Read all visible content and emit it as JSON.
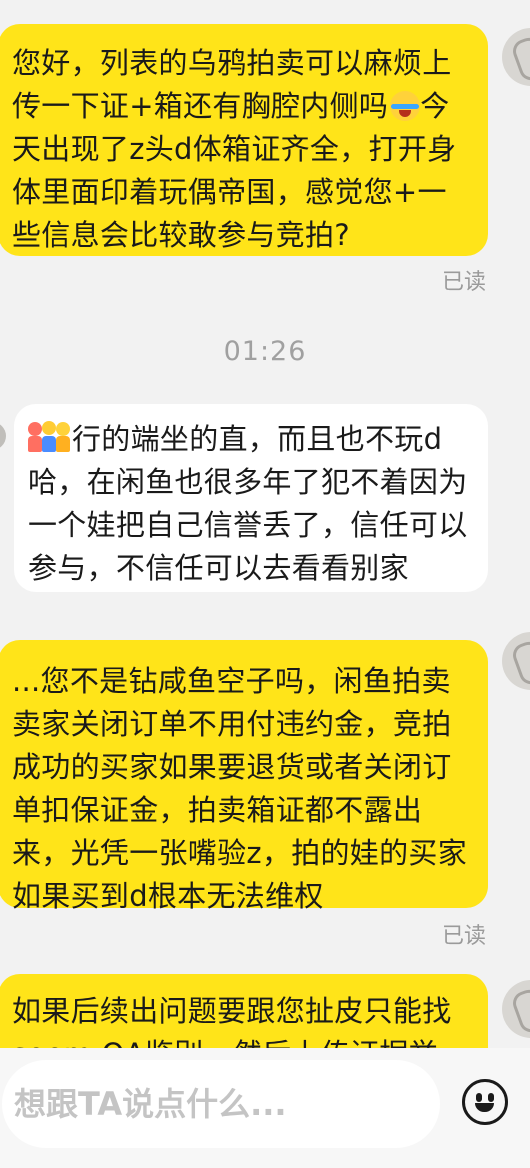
{
  "messages": [
    {
      "side": "me",
      "parts": [
        "您好，列表的乌鸦拍卖可以麻烦上传一下证+箱还有胸腔内侧吗",
        "今天出现了z头d体箱证齐全，打开身体里面印着玩偶帝国，感觉您+一些信息会比较敢参与竞拍?"
      ],
      "emoji": "crying-laughing-emoji",
      "read": "已读"
    },
    {
      "side": "them",
      "emoji": "people-group-emoji",
      "text": "行的端坐的直，而且也不玩d哈，在闲鱼也很多年了犯不着因为一个娃把自己信誉丢了，信任可以参与，不信任可以去看看别家"
    },
    {
      "side": "me",
      "text": "...您不是钻咸鱼空子吗，闲鱼拍卖卖家关闭订单不用付违约金，竞拍成功的买家如果要退货或者关闭订单扣保证金，拍卖箱证都不露出来，光凭一张嘴验z，拍的娃的买家如果买到d根本无法维权",
      "read": "已读"
    },
    {
      "side": "me",
      "text": "如果后续出问题要跟您扯皮只能找soem QA鉴别，然后上传证据举"
    }
  ],
  "timestamp": "01:26",
  "input": {
    "placeholder": "想跟TA说点什么..."
  },
  "colors": {
    "my_bubble": "#ffe419",
    "their_bubble": "#ffffff",
    "background": "#f2f2f2"
  }
}
